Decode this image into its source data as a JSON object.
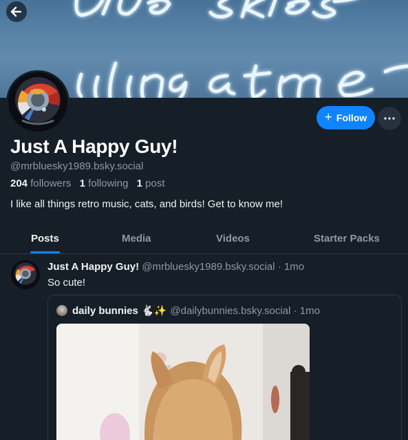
{
  "navigation": {
    "back_label": "Back"
  },
  "banner": {
    "neon_text_line1": "blue skies",
    "neon_text_line2": "smiling at me"
  },
  "profile": {
    "display_name": "Just A Happy Guy!",
    "handle": "@mrbluesky1989.bsky.social",
    "followers_count": "204",
    "followers_label": "followers",
    "following_count": "1",
    "following_label": "following",
    "posts_count": "1",
    "posts_label": "post",
    "bio": "I like all things retro music, cats, and birds! Get to know me!"
  },
  "actions": {
    "follow_icon": "+",
    "follow_label": "Follow",
    "more_icon": "ellipsis-icon"
  },
  "tabs": [
    {
      "label": "Posts",
      "active": true
    },
    {
      "label": "Media",
      "active": false
    },
    {
      "label": "Videos",
      "active": false
    },
    {
      "label": "Starter Packs",
      "active": false
    }
  ],
  "feed": {
    "post": {
      "author_name": "Just A Happy Guy!",
      "author_handle": "@mrbluesky1989.bsky.social",
      "time": "· 1mo",
      "text": "So cute!",
      "quote": {
        "author_name": "daily bunnies 🐇✨",
        "author_handle": "@dailybunnies.bsky.social",
        "time": "· 1mo"
      }
    }
  },
  "colors": {
    "background": "#161e27",
    "accent": "#1083fe",
    "muted_text": "#8d99a8",
    "border": "#2e3947"
  }
}
